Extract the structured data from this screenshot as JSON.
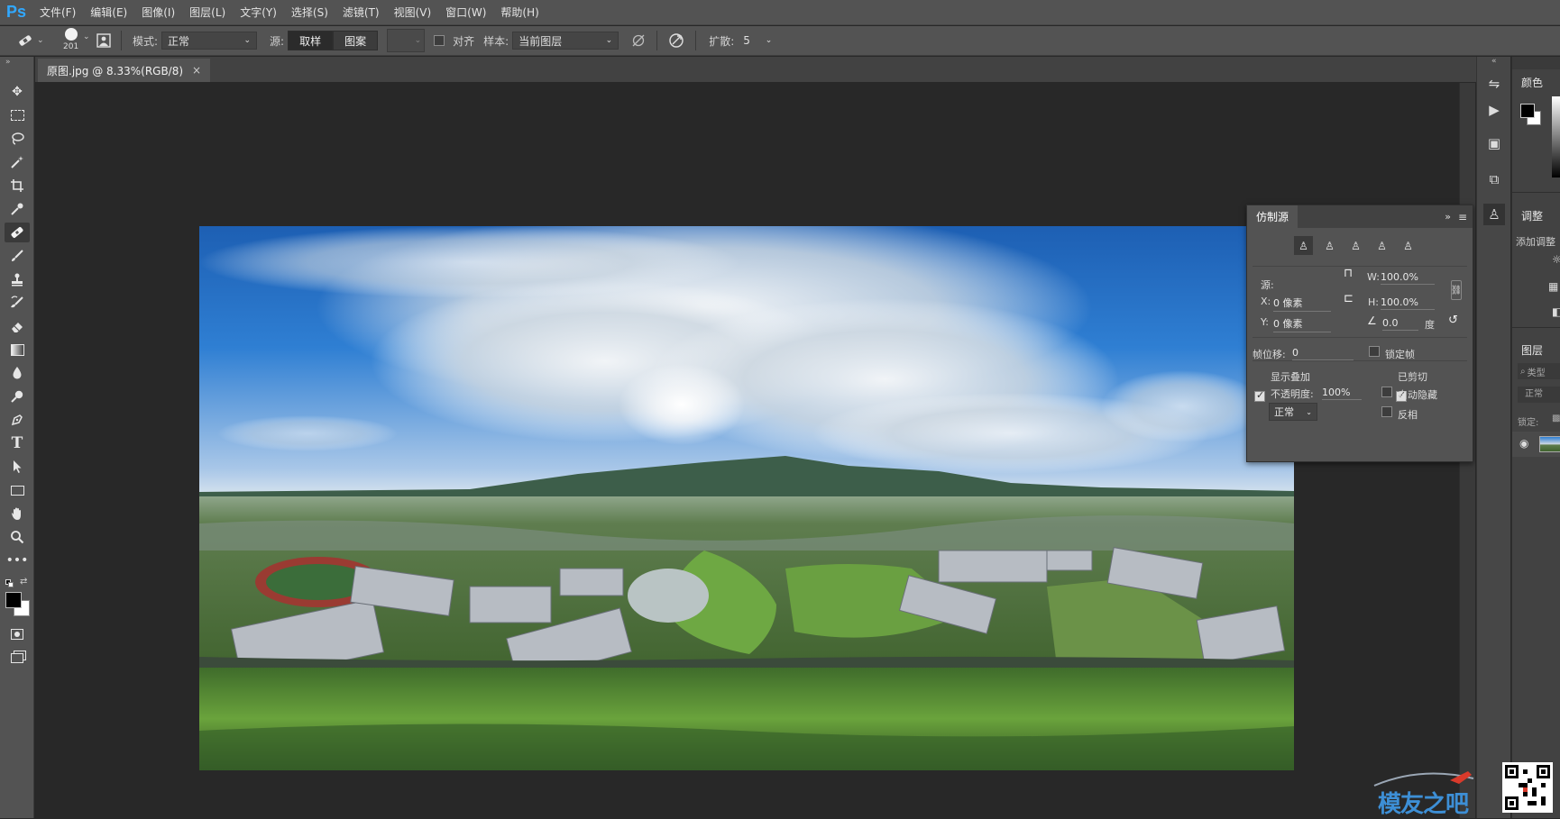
{
  "app": {
    "logo": "Ps"
  },
  "menu": [
    "文件(F)",
    "编辑(E)",
    "图像(I)",
    "图层(L)",
    "文字(Y)",
    "选择(S)",
    "滤镜(T)",
    "视图(V)",
    "窗口(W)",
    "帮助(H)"
  ],
  "options": {
    "brush_size": "201",
    "mode_label": "模式:",
    "mode_value": "正常",
    "source_label": "源:",
    "source_sample": "取样",
    "source_pattern": "图案",
    "align_label": "对齐",
    "sample_label": "样本:",
    "sample_value": "当前图层",
    "diffusion_label": "扩散:",
    "diffusion_value": "5"
  },
  "document": {
    "tab_title": "原图.jpg @ 8.33%(RGB/8)",
    "close_glyph": "×"
  },
  "clone_source_panel": {
    "title": "仿制源",
    "source_label": "源:",
    "w_label": "W:",
    "w_value": "100.0%",
    "h_label": "H:",
    "h_value": "100.0%",
    "x_label": "X:",
    "x_value": "0 像素",
    "y_label": "Y:",
    "y_value": "0 像素",
    "angle_value": "0.0",
    "angle_unit": "度",
    "frame_offset_label": "帧位移:",
    "frame_offset_value": "0",
    "lock_frame_label": "锁定帧",
    "show_overlay_label": "显示叠加",
    "clipped_label": "已剪切",
    "opacity_label": "不透明度:",
    "opacity_value": "100%",
    "auto_hide_label": "自动隐藏",
    "blend_value": "正常",
    "invert_label": "反相"
  },
  "right_panels": {
    "color_tab": "颜色",
    "adjust_tab": "调整",
    "adjust_hint": "添加调整",
    "layers_tab": "图层",
    "layers_filter": "类型",
    "layers_mode": "正常",
    "layers_lock": "锁定:"
  },
  "watermark": {
    "text": "模友之吧"
  }
}
